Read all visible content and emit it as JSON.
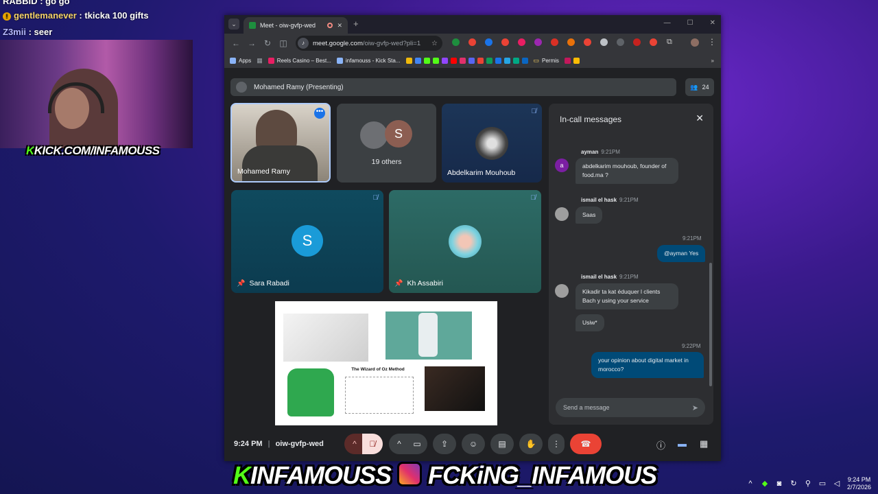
{
  "stream": {
    "chat": [
      {
        "user": "RABBID",
        "text": ": go go"
      },
      {
        "user": "gentlemanever",
        "text": ": tkicka 100 gifts"
      },
      {
        "user": "Z3mii",
        "text": ": seer"
      }
    ],
    "kick_logo": "KICK.COM/INFAMOUSS",
    "banner_left": "INFAMOUSS",
    "banner_right": "FCKiNG_INFAMOUS"
  },
  "browser": {
    "tab_title": "Meet - oiw-gvfp-wed",
    "url_host": "meet.google.com",
    "url_path": "/oiw-gvfp-wed?pli=1",
    "bookmarks": [
      {
        "label": "Apps",
        "color": "#8ab4f8"
      },
      {
        "label": "",
        "color": "#9aa0a6"
      },
      {
        "label": "Reels Casino – Best...",
        "color": "#e91e63"
      },
      {
        "label": "infamouss - Kick Sta...",
        "color": "#8ab4f8"
      },
      {
        "label": "Permis",
        "color": "#fdd663"
      }
    ],
    "extension_colors": [
      "#1e8e3e",
      "#ea4335",
      "#1a73e8",
      "#ea4335",
      "#e91e63",
      "#9c27b0",
      "#d93025",
      "#e8710a",
      "#ea4335",
      "#bdc1c6",
      "#5f6368",
      "#c5221f",
      "#ea4335"
    ]
  },
  "meet": {
    "presenting_label": "Mohamed Ramy (Presenting)",
    "participant_count": "24",
    "tiles": {
      "mohamed": "Mohamed Ramy",
      "others": "19 others",
      "others_initial": "S",
      "abdelkarim": "Abdelkarim Mouhoub",
      "sara": "Sara Rabadi",
      "sara_initial": "S",
      "kh": "Kh Assabiri"
    },
    "slide_caption": "The Wizard of Oz Method",
    "chat": {
      "title": "In-call messages",
      "messages": [
        {
          "sender": "ayman",
          "time": "9:21PM",
          "text": "abdelkarim mouhoub, founder of food.ma ?"
        },
        {
          "sender": "ismail el hask",
          "time": "9:21PM",
          "text": "Saas"
        },
        {
          "sender": "",
          "time": "9:21PM",
          "text": "@ayman Yes"
        },
        {
          "sender": "ismail el hask",
          "time": "9:21PM",
          "text": "Kikadir ta kat éduquer l clients Bach y using your service"
        },
        {
          "sender": "",
          "time": "",
          "text": "Usiw*"
        },
        {
          "sender": "",
          "time": "9:22PM",
          "text": "your opinion about digital market in morocco?"
        }
      ],
      "ayman_initial": "a",
      "input_placeholder": "Send a message"
    },
    "time": "9:24 PM",
    "separator": "|",
    "meeting_code": "oiw-gvfp-wed"
  },
  "tray": {
    "time": "9:24 PM",
    "date": "2/7/2026"
  }
}
